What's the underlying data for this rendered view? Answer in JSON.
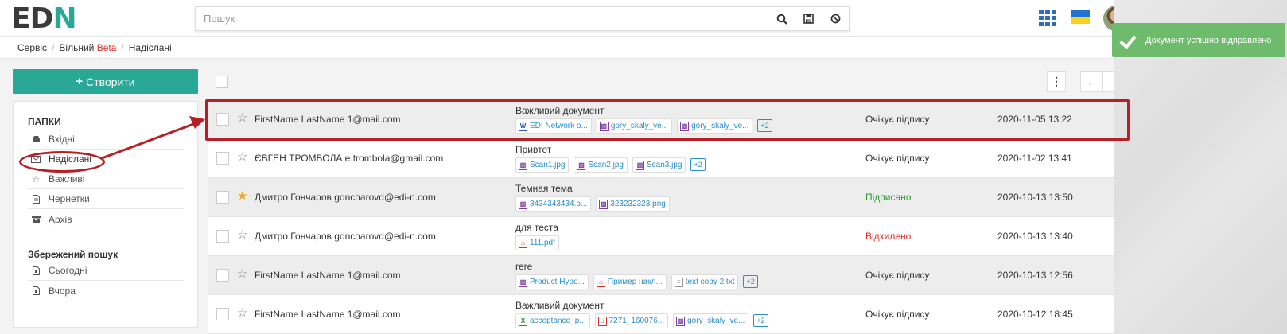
{
  "header": {
    "logo_text": "ED",
    "logo_mark": "N",
    "search_placeholder": "Пошук",
    "search_icon": "search-icon",
    "save_icon": "save-icon",
    "clear_icon": "ban-icon"
  },
  "toast": {
    "message": "Документ успішно відправлено",
    "color": "#6dbb6b"
  },
  "breadcrumb": {
    "item1": "Сервіс",
    "item2": "Вільний",
    "item2_badge": "Beta",
    "item3": "Надіслані"
  },
  "sidebar": {
    "create_label": "Створити",
    "folders_title": "ПАПКИ",
    "folders": [
      {
        "label": "Вхідні",
        "icon": "inbox-icon"
      },
      {
        "label": "Надіслані",
        "icon": "envelope-icon"
      },
      {
        "label": "Важливі",
        "icon": "star-icon"
      },
      {
        "label": "Чернетки",
        "icon": "file-icon"
      },
      {
        "label": "Архів",
        "icon": "archive-icon"
      }
    ],
    "saved_title": "Збережений пошук",
    "saved": [
      {
        "label": "Сьогодні",
        "icon": "file-icon"
      },
      {
        "label": "Вчора",
        "icon": "file-icon"
      }
    ]
  },
  "list": {
    "rows": [
      {
        "starred": false,
        "sender": "FirstName LastName 1@mail.com",
        "subject": "Важливий документ",
        "attachments": [
          {
            "type": "doc",
            "name": "EDI Network o..."
          },
          {
            "type": "img",
            "name": "gory_skaly_ve..."
          },
          {
            "type": "img",
            "name": "gory_skaly_ve..."
          }
        ],
        "more": "+2",
        "status": "Очікує підпису",
        "status_kind": "pending",
        "date": "2020-11-05 13:22"
      },
      {
        "starred": false,
        "sender": "ЄВГЕН ТРОМБОЛА e.trombola@gmail.com",
        "subject": "Привтет",
        "attachments": [
          {
            "type": "img",
            "name": "Scan1.jpg"
          },
          {
            "type": "img",
            "name": "Scan2.jpg"
          },
          {
            "type": "img",
            "name": "Scan3.jpg"
          }
        ],
        "more": "+2",
        "status": "Очікує підпису",
        "status_kind": "pending",
        "date": "2020-11-02 13:41"
      },
      {
        "starred": true,
        "sender": "Дмитро Гончаров goncharovd@edi-n.com",
        "subject": "Темная тема",
        "attachments": [
          {
            "type": "img",
            "name": "3434343434.p..."
          },
          {
            "type": "img",
            "name": "323232323.png"
          }
        ],
        "more": "",
        "status": "Підписано",
        "status_kind": "signed",
        "date": "2020-10-13 13:50"
      },
      {
        "starred": false,
        "sender": "Дмитро Гончаров goncharovd@edi-n.com",
        "subject": "для теста",
        "attachments": [
          {
            "type": "pdf",
            "name": "111.pdf"
          }
        ],
        "more": "",
        "status": "Відхилено",
        "status_kind": "rejected",
        "date": "2020-10-13 13:40"
      },
      {
        "starred": false,
        "sender": "FirstName LastName 1@mail.com",
        "subject": "rere",
        "attachments": [
          {
            "type": "img",
            "name": "Product Hypo..."
          },
          {
            "type": "pdf",
            "name": "Пример накл..."
          },
          {
            "type": "txt",
            "name": "text copy 2.txt"
          }
        ],
        "more": "+2",
        "status": "Очікує підпису",
        "status_kind": "pending",
        "date": "2020-10-13 12:56"
      },
      {
        "starred": false,
        "sender": "FirstName LastName 1@mail.com",
        "subject": "Важливий документ",
        "attachments": [
          {
            "type": "xls",
            "name": "acceptance_p..."
          },
          {
            "type": "pdf",
            "name": "7271_160076..."
          },
          {
            "type": "img",
            "name": "gory_skaly_ve..."
          }
        ],
        "more": "+2",
        "status": "Очікує підпису",
        "status_kind": "pending",
        "date": "2020-10-12 18:45"
      }
    ]
  },
  "colors": {
    "accent": "#2aa897",
    "annotation": "#b51f25",
    "link": "#2a8fc9"
  }
}
